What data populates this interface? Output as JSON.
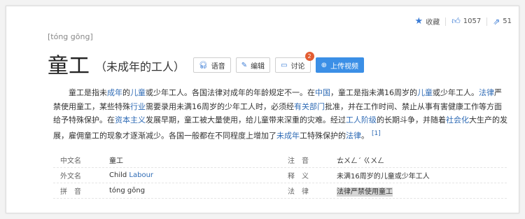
{
  "topbar": {
    "favorite_label": "收藏",
    "like_count": "1057",
    "share_count": "51"
  },
  "header": {
    "pinyin": "[tóng gōng]",
    "title": "童工",
    "subtitle": "（未成年的工人）"
  },
  "buttons": {
    "voice": "语音",
    "edit": "编辑",
    "discuss": "讨论",
    "discuss_badge": "2",
    "upload_video": "上传视频"
  },
  "paragraph": {
    "p1": "童工是指未",
    "l1": "成年",
    "p2": "的",
    "l2": "儿童",
    "p3": "或少年工人。各国法律对成年的年龄规定不一。在",
    "l3": "中国",
    "p4": "，童工是指未满16周岁的",
    "l4": "儿童",
    "p5": "或少年工人。",
    "l5": "法律",
    "p6": "严禁使用童工，某些特殊",
    "l6": "行业",
    "p7": "需要录用未满16周岁的少年工人时，必须经",
    "l7": "有关部门",
    "p8": "批准，并在工作时间、禁止从事有害健康工作等方面给予特殊保护。在",
    "l8": "资本主义",
    "p9": "发展早期，童工被大量使用，给儿童带来深重的灾难。经过",
    "l9": "工人阶级",
    "p10": "的长期斗争，并随着",
    "l10": "社会化",
    "p11": "大生产的发展，雇佣童工的现象才逐渐减少。各国一般都在不同程度上增加了",
    "l11": "未成年",
    "p12": "工特殊保护的",
    "l12": "法律",
    "p13": "。",
    "ref": "[1]"
  },
  "info": {
    "rows": [
      {
        "label1": "中文名",
        "value1": "童工",
        "label2": "注　音",
        "value2": "ㄊㄨㄥˊ ㄍㄨㄥ"
      },
      {
        "label1": "外文名",
        "value1a": "Child ",
        "value1b": "Labour",
        "label2": "释　义",
        "value2": "未满16周岁的儿童或少年工人"
      },
      {
        "label1": "拼　音",
        "value1": "tóng gōng",
        "label2": "法　律",
        "value2": "法律严禁使用童工"
      }
    ]
  }
}
